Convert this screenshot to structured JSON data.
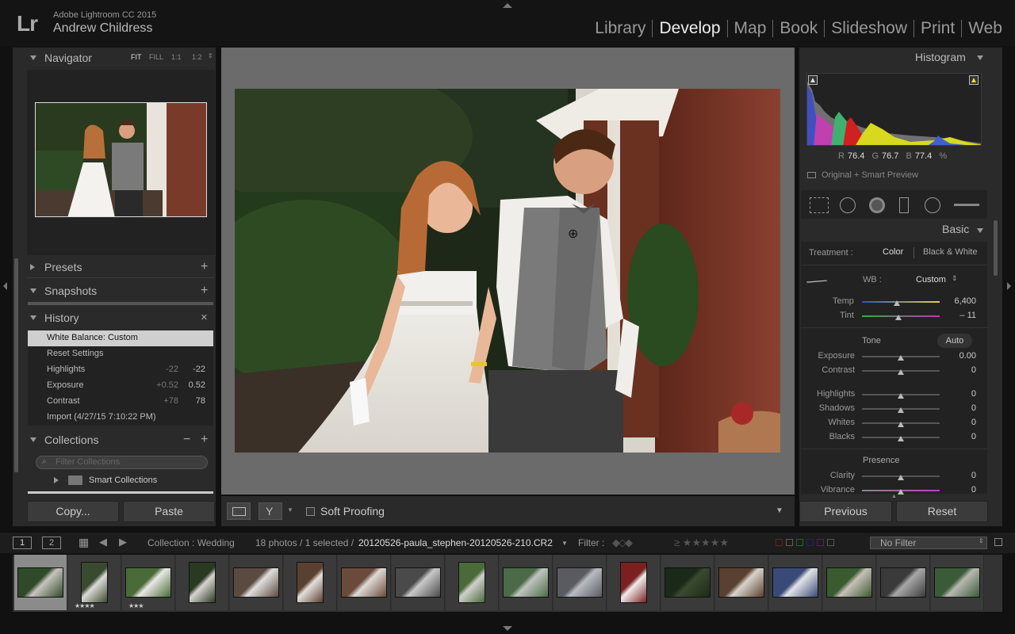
{
  "app": {
    "logo": "Lr",
    "name": "Adobe Lightroom CC 2015",
    "user": "Andrew Childress"
  },
  "modules": [
    "Library",
    "Develop",
    "Map",
    "Book",
    "Slideshow",
    "Print",
    "Web"
  ],
  "active_module": "Develop",
  "navigator": {
    "title": "Navigator",
    "zoom": [
      "FIT",
      "FILL",
      "1:1",
      "1:2"
    ]
  },
  "left_panels": {
    "presets": "Presets",
    "snapshots": "Snapshots",
    "history": "History",
    "collections": "Collections",
    "filter_placeholder": "Filter Collections",
    "smart_collections": "Smart Collections"
  },
  "history": [
    {
      "name": "White Balance: Custom",
      "v1": "",
      "v2": ""
    },
    {
      "name": "Reset Settings",
      "v1": "",
      "v2": ""
    },
    {
      "name": "Highlights",
      "v1": "-22",
      "v2": "-22"
    },
    {
      "name": "Exposure",
      "v1": "+0.52",
      "v2": "0.52"
    },
    {
      "name": "Contrast",
      "v1": "+78",
      "v2": "78"
    },
    {
      "name": "Import (4/27/15 7:10:22 PM)",
      "v1": "",
      "v2": ""
    }
  ],
  "left_buttons": {
    "copy": "Copy...",
    "paste": "Paste"
  },
  "toolbar": {
    "soft_proofing": "Soft Proofing"
  },
  "histogram": {
    "title": "Histogram",
    "r_label": "R",
    "r": "76.4",
    "g_label": "G",
    "g": "76.7",
    "b_label": "B",
    "b": "77.4",
    "unit": "%",
    "preview": "Original + Smart Preview"
  },
  "basic": {
    "title": "Basic",
    "treatment_label": "Treatment :",
    "color": "Color",
    "bw": "Black & White",
    "wb_label": "WB :",
    "wb_value": "Custom",
    "temp_label": "Temp",
    "temp": "6,400",
    "temp_pos": 0.45,
    "tint_label": "Tint",
    "tint": "– 11",
    "tint_pos": 0.47,
    "tone": "Tone",
    "auto": "Auto",
    "sliders": [
      {
        "label": "Exposure",
        "value": "0.00"
      },
      {
        "label": "Contrast",
        "value": "0"
      },
      {
        "label": "Highlights",
        "value": "0"
      },
      {
        "label": "Shadows",
        "value": "0"
      },
      {
        "label": "Whites",
        "value": "0"
      },
      {
        "label": "Blacks",
        "value": "0"
      }
    ],
    "presence": "Presence",
    "presence_sliders": [
      {
        "label": "Clarity",
        "value": "0"
      },
      {
        "label": "Vibrance",
        "value": "0"
      }
    ]
  },
  "right_buttons": {
    "previous": "Previous",
    "reset": "Reset"
  },
  "filmstrip_bar": {
    "view1": "1",
    "view2": "2",
    "collection": "Collection : Wedding",
    "count": "18 photos / 1 selected /",
    "filename": "20120526-paula_stephen-20120526-210.CR2",
    "filter_label": "Filter :",
    "no_filter": "No Filter"
  },
  "thumbnails": [
    {
      "stars": "",
      "colors": [
        "#2f4a28",
        "#c8c4c0"
      ]
    },
    {
      "stars": "★★★★",
      "colors": [
        "#3a4a30",
        "#dcdad6"
      ]
    },
    {
      "stars": "★★★",
      "colors": [
        "#4a6a38",
        "#e8e8e4"
      ]
    },
    {
      "stars": "",
      "colors": [
        "#2a3a22",
        "#d8d4d0"
      ]
    },
    {
      "stars": "",
      "colors": [
        "#5a4a40",
        "#e0dedc"
      ]
    },
    {
      "stars": "",
      "colors": [
        "#5a4030",
        "#e4e0dc"
      ]
    },
    {
      "stars": "",
      "colors": [
        "#6a4a3a",
        "#dedad6"
      ]
    },
    {
      "stars": "",
      "colors": [
        "#4a4a4a",
        "#c8c8c8"
      ]
    },
    {
      "stars": "",
      "colors": [
        "#4a6a3a",
        "#d0d0cc"
      ]
    },
    {
      "stars": "",
      "colors": [
        "#4a6a48",
        "#c0c4c0"
      ]
    },
    {
      "stars": "",
      "colors": [
        "#5a5a60",
        "#b8bcc0"
      ]
    },
    {
      "stars": "",
      "colors": [
        "#7a2020",
        "#f0ecec"
      ]
    },
    {
      "stars": "",
      "colors": [
        "#1a2a18",
        "#3a4a30"
      ]
    },
    {
      "stars": "",
      "colors": [
        "#5a4030",
        "#d8d4cc"
      ]
    },
    {
      "stars": "",
      "colors": [
        "#3a4a78",
        "#e4e4e8"
      ]
    },
    {
      "stars": "",
      "colors": [
        "#3a5a30",
        "#c8c0b8"
      ]
    },
    {
      "stars": "",
      "colors": [
        "#3a3a3a",
        "#a8a8a8"
      ]
    },
    {
      "stars": "",
      "colors": [
        "#3a5a38",
        "#b8b8b0"
      ]
    }
  ]
}
